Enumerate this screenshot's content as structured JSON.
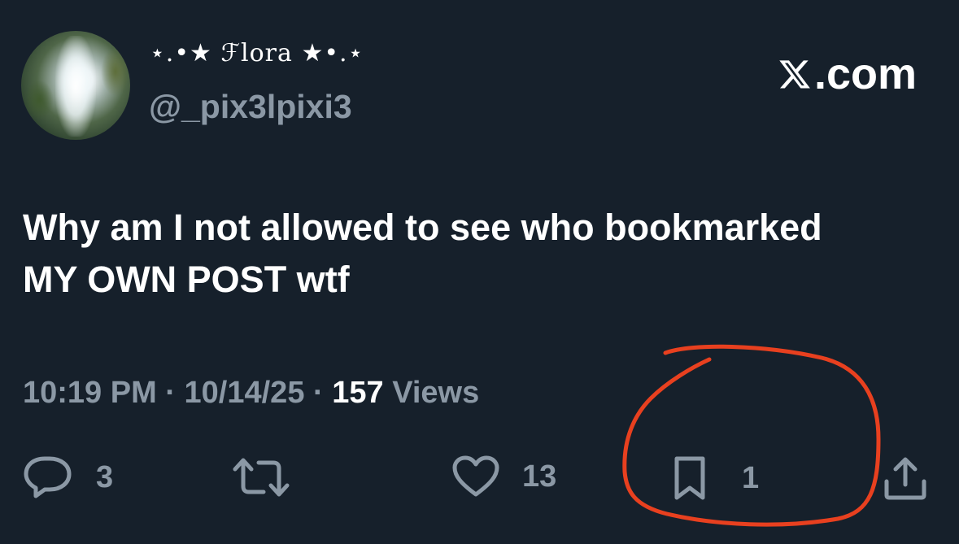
{
  "author": {
    "display_name": "⋆.•★ ℱlora ★•.⋆",
    "handle": "@_pix3lpixi3"
  },
  "brand": {
    "label": ".com",
    "icon": "x-logo-icon"
  },
  "post": {
    "text_line1": "Why am I not allowed to see who bookmarked",
    "text_line2": "MY OWN POST wtf"
  },
  "meta": {
    "time": "10:19 PM",
    "separator": " · ",
    "date": "10/14/25",
    "views_count": "157",
    "views_label": " Views"
  },
  "actions": {
    "reply": {
      "icon": "reply-icon",
      "count": "3"
    },
    "repost": {
      "icon": "repost-icon",
      "count": ""
    },
    "like": {
      "icon": "heart-icon",
      "count": "13"
    },
    "bookmark": {
      "icon": "bookmark-icon",
      "count": "1"
    },
    "share": {
      "icon": "share-icon"
    }
  },
  "colors": {
    "background": "#16202b",
    "primary_text": "#ffffff",
    "secondary_text": "#8b98a5",
    "annotation": "#e8401f"
  }
}
